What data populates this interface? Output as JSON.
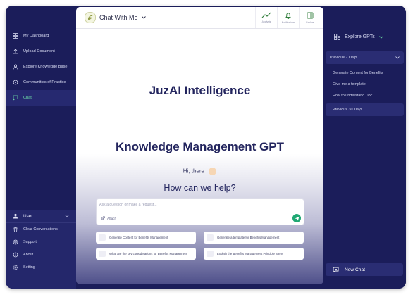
{
  "sidebar": {
    "items": [
      {
        "label": "My Dashboard",
        "icon": "grid-icon"
      },
      {
        "label": "Upload Document",
        "icon": "upload-icon"
      },
      {
        "label": "Explore Knowledge Base",
        "icon": "person-icon"
      },
      {
        "label": "Communities of Practice",
        "icon": "community-icon"
      },
      {
        "label": "Chat",
        "icon": "chat-icon"
      }
    ],
    "active_index": 4
  },
  "user_menu": {
    "user_label": "User",
    "items": [
      {
        "label": "Clear Conversations",
        "icon": "trash-icon"
      },
      {
        "label": "Support",
        "icon": "support-icon"
      },
      {
        "label": "About",
        "icon": "info-icon"
      },
      {
        "label": "Setting",
        "icon": "gear-icon"
      }
    ]
  },
  "topbar": {
    "title": "Chat With Me",
    "actions": [
      {
        "label": "Analysis",
        "icon": "chart-icon"
      },
      {
        "label": "Notifications",
        "icon": "bell-icon"
      },
      {
        "label": "Explore",
        "icon": "panel-icon"
      }
    ]
  },
  "main": {
    "heading": "JuzAI Intelligence",
    "subheading": "Knowledge Management GPT",
    "greeting": "Hi, there",
    "prompt": "How can we help?",
    "input_placeholder": "Ask a question or make a request...",
    "attach_label": "Attach",
    "suggestions": [
      "Generate Content for Benefits Management",
      "Generate a template for Benefits Management",
      "What are the key considerations for Benefits Management",
      "Explain the Benefits Management Principle Steps"
    ]
  },
  "right_panel": {
    "explore_label": "Explore GPTs",
    "previous_7": "Previous 7 Days",
    "history": [
      "Generate Content for Benefits",
      "Give me a template",
      "How to understand Doc"
    ],
    "previous_30": "Previous 30 Days",
    "new_chat": "New Chat"
  },
  "colors": {
    "sidebar_bg": "#1b1d5a",
    "active_accent": "#6fe0a8",
    "heading": "#23255e",
    "send_button": "#1fa873"
  }
}
